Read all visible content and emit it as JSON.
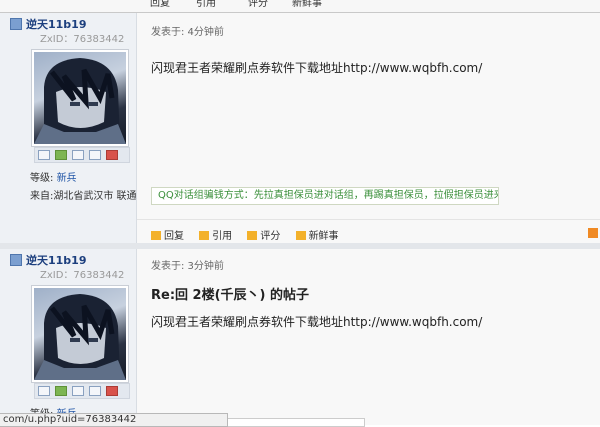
{
  "prev_actions": [
    "回复",
    "引用",
    "评分",
    "新鲜事"
  ],
  "posts": [
    {
      "username": "逆天11b19",
      "zxid": "ZxID：76383442",
      "posted": "发表于: 4分钟前",
      "title": "",
      "content": "闪现君王者荣耀刷点券软件下载地址http://www.wqbfh.com/",
      "level_label": "等级: ",
      "level_value": "新兵",
      "from": "来自:湖北省武汉市 联通",
      "notice": "QQ对话组骗钱方式：先拉真担保员进对话组，再踢真担保员，拉假担保员进来骗钱。",
      "actions": [
        "回复",
        "引用",
        "评分",
        "新鲜事"
      ]
    },
    {
      "username": "逆天11b19",
      "zxid": "ZxID：76383442",
      "posted": "发表于: 3分钟前",
      "title": "Re:回 2楼(千辰丶) 的帖子",
      "content": "闪现君王者荣耀刷点券软件下载地址http://www.wqbfh.com/",
      "level_label": "等级: ",
      "level_value": "新兵"
    }
  ],
  "status_url": "com/u.php?uid=76383442"
}
